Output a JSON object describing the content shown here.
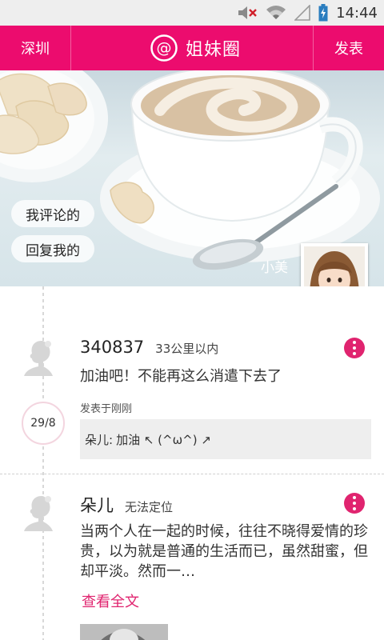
{
  "status_bar": {
    "time": "14:44",
    "icons": [
      "muted-volume-icon",
      "wifi-icon",
      "no-signal-icon",
      "battery-charging-icon"
    ]
  },
  "top_nav": {
    "city": "深圳",
    "logo_icon": "at-sign-icon",
    "title": "姐妹圈",
    "publish": "发表"
  },
  "banner": {
    "my_comments": "我评论的",
    "replies_to_me": "回复我的",
    "profile_name": "小美"
  },
  "posts": [
    {
      "username": "340837",
      "distance": "33公里以内",
      "content": "加油吧！不能再这么消遣下去了",
      "posted_time": "发表于刚刚",
      "date": "29/8",
      "comment": {
        "user": "朵儿:",
        "text": "加油 ↖ (^ω^) ↗"
      }
    },
    {
      "username": "朵儿",
      "distance": "无法定位",
      "content": "当两个人在一起的时候，往往不晓得爱情的珍贵，以为就是普通的生活而已，虽然甜蜜，但却平淡。然而一…",
      "read_more": "查看全文"
    }
  ],
  "colors": {
    "brand": "#ec0c6e",
    "accent": "#e0246f",
    "status_bar": "#eeeeee"
  }
}
